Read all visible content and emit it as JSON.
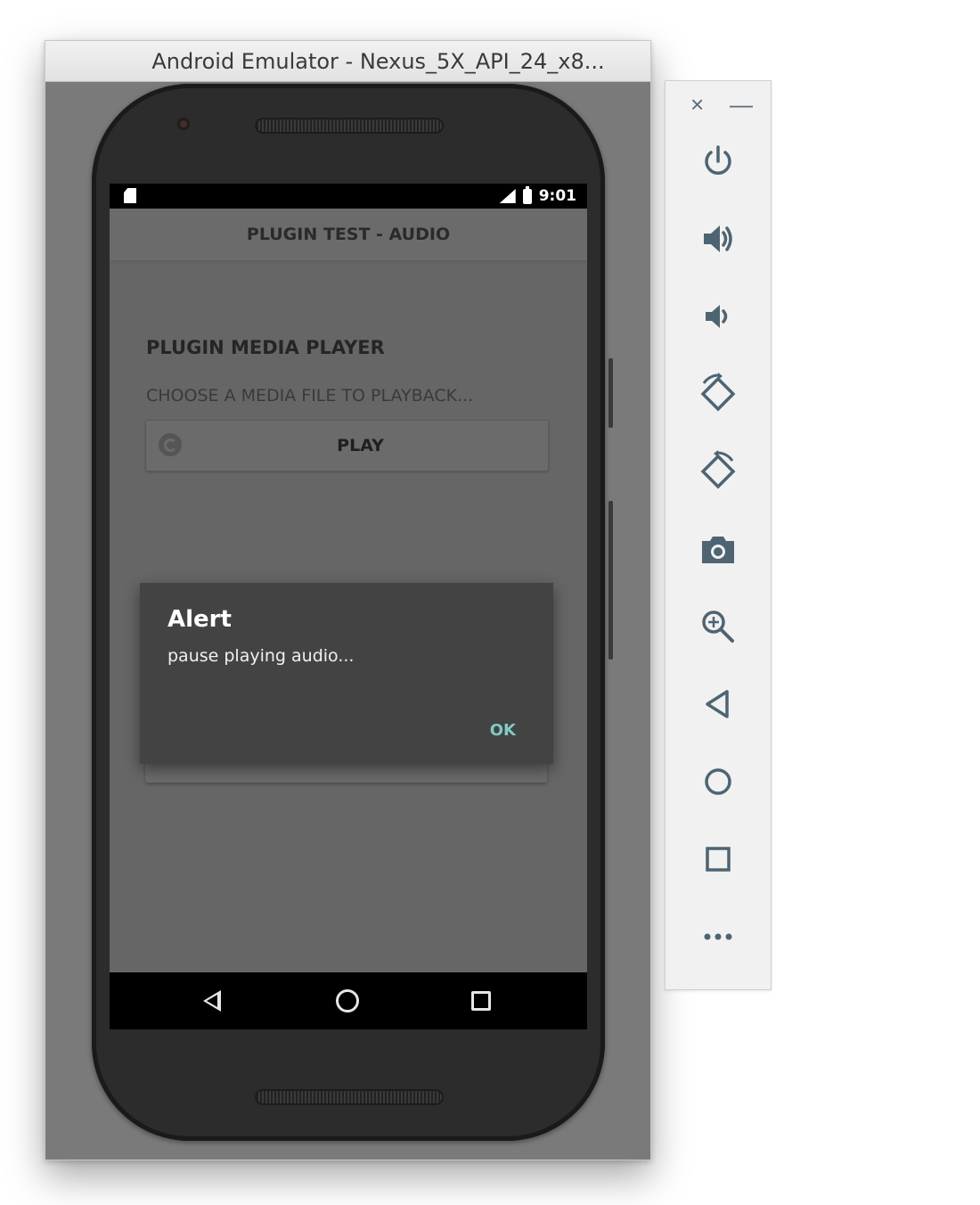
{
  "window": {
    "title": "Android Emulator - Nexus_5X_API_24_x8..."
  },
  "status_bar": {
    "time": "9:01"
  },
  "app": {
    "toolbar_title": "PLUGIN TEST - AUDIO",
    "heading": "PLUGIN MEDIA PLAYER",
    "subheading": "CHOOSE A MEDIA FILE TO PLAYBACK...",
    "play_label": "PLAY"
  },
  "dialog": {
    "title": "Alert",
    "message": "pause playing audio...",
    "ok_label": "OK"
  },
  "side_toolbar": {
    "close_glyph": "×",
    "minimize_glyph": "—",
    "buttons": [
      {
        "icon": "power-icon"
      },
      {
        "icon": "volume-up-icon"
      },
      {
        "icon": "volume-down-icon"
      },
      {
        "icon": "rotate-left-icon"
      },
      {
        "icon": "rotate-right-icon"
      },
      {
        "icon": "camera-icon"
      },
      {
        "icon": "zoom-icon"
      },
      {
        "icon": "back-icon"
      },
      {
        "icon": "home-icon"
      },
      {
        "icon": "overview-icon"
      },
      {
        "icon": "more-icon"
      }
    ]
  },
  "colors": {
    "toolbar_icon": "#4e6472",
    "dialog_accent": "#80cbc4"
  }
}
